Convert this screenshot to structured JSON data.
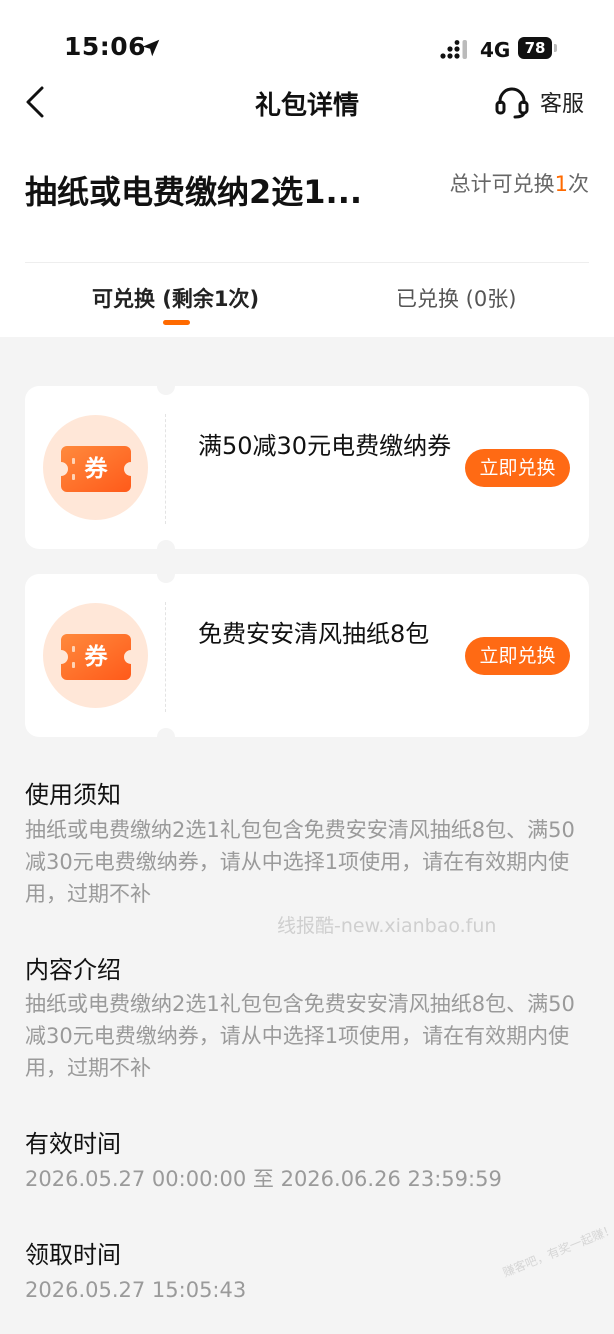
{
  "status_bar": {
    "time": "15:06",
    "network": "4G",
    "battery": "78"
  },
  "nav": {
    "title": "礼包详情",
    "service_label": "客服"
  },
  "gift": {
    "title": "抽纸或电费缴纳2选1...",
    "total_prefix": "总计可兑换",
    "total_count": "1",
    "total_suffix": "次"
  },
  "tabs": [
    {
      "label": "可兑换 (剩余1次)",
      "active": true
    },
    {
      "label": "已兑换 (0张)",
      "active": false
    }
  ],
  "coupons": [
    {
      "icon_text": "券",
      "title": "满50减30元电费缴纳券",
      "button": "立即兑换"
    },
    {
      "icon_text": "券",
      "title": "免费安安清风抽纸8包",
      "button": "立即兑换"
    }
  ],
  "sections": [
    {
      "title": "使用须知",
      "text": "抽纸或电费缴纳2选1礼包包含免费安安清风抽纸8包、满50减30元电费缴纳券，请从中选择1项使用，请在有效期内使用，过期不补"
    },
    {
      "title": "内容介绍",
      "text": "抽纸或电费缴纳2选1礼包包含免费安安清风抽纸8包、满50减30元电费缴纳券，请从中选择1项使用，请在有效期内使用，过期不补"
    },
    {
      "title": "有效时间",
      "text": "2026.05.27 00:00:00 至 2026.06.26 23:59:59"
    },
    {
      "title": "领取时间",
      "text": "2026.05.27 15:05:43"
    }
  ],
  "watermark": "线报酷-new.xianbao.fun",
  "corner_watermark": "赚客吧，有奖一起赚！ www.zuanke8.com",
  "colors": {
    "accent": "#ff6a14",
    "icon_bg": "#ffe7d8",
    "muted_text": "#9a9a9a"
  }
}
